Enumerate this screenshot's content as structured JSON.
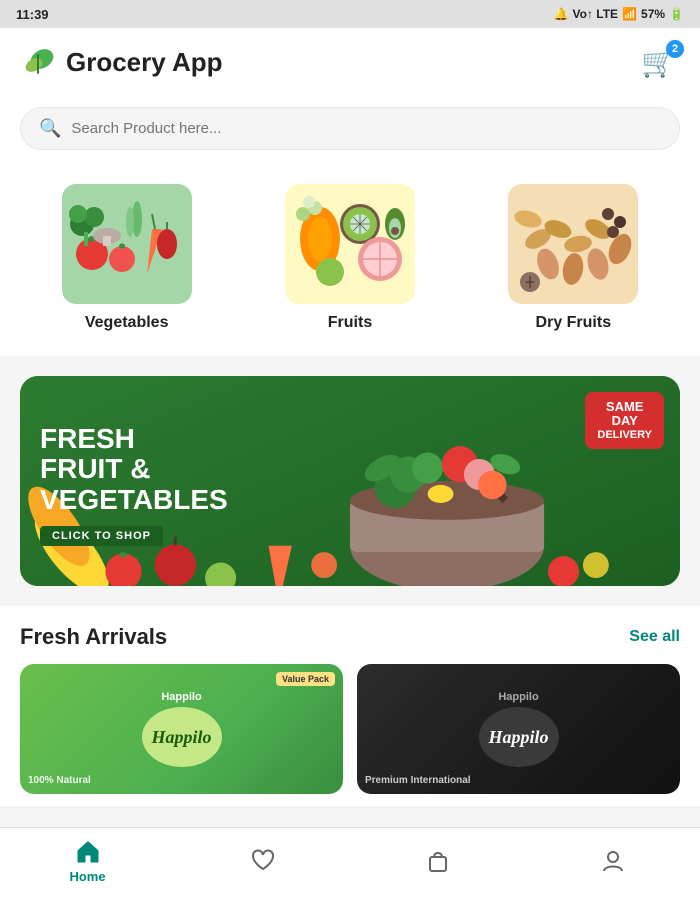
{
  "statusBar": {
    "time": "11:39",
    "battery": "57%"
  },
  "header": {
    "appTitle": "Grocery App",
    "cartBadge": "2"
  },
  "search": {
    "placeholder": "Search Product here..."
  },
  "categories": [
    {
      "id": "vegetables",
      "label": "Vegetables"
    },
    {
      "id": "fruits",
      "label": "Fruits"
    },
    {
      "id": "dry-fruits",
      "label": "Dry Fruits"
    }
  ],
  "banner": {
    "mainText": "FRESH\nFRUIT &\nVEGETABLES",
    "badge1": "SAME",
    "badge2": "DAY",
    "badge3": "DELIVERY",
    "cta": "CLICK TO SHOP"
  },
  "freshArrivals": {
    "title": "Fresh Arrivals",
    "seeAll": "See all",
    "items": [
      {
        "id": "happilo-green",
        "brand": "Happilo",
        "tag": "Value Pack",
        "sublabel": "100% Natural"
      },
      {
        "id": "happilo-dark",
        "brand": "Happilo",
        "sublabel": "Premium International"
      }
    ]
  },
  "bottomNav": [
    {
      "id": "home",
      "label": "Home",
      "active": true
    },
    {
      "id": "wishlist",
      "label": "",
      "active": false
    },
    {
      "id": "cart",
      "label": "",
      "active": false
    },
    {
      "id": "profile",
      "label": "",
      "active": false
    }
  ]
}
